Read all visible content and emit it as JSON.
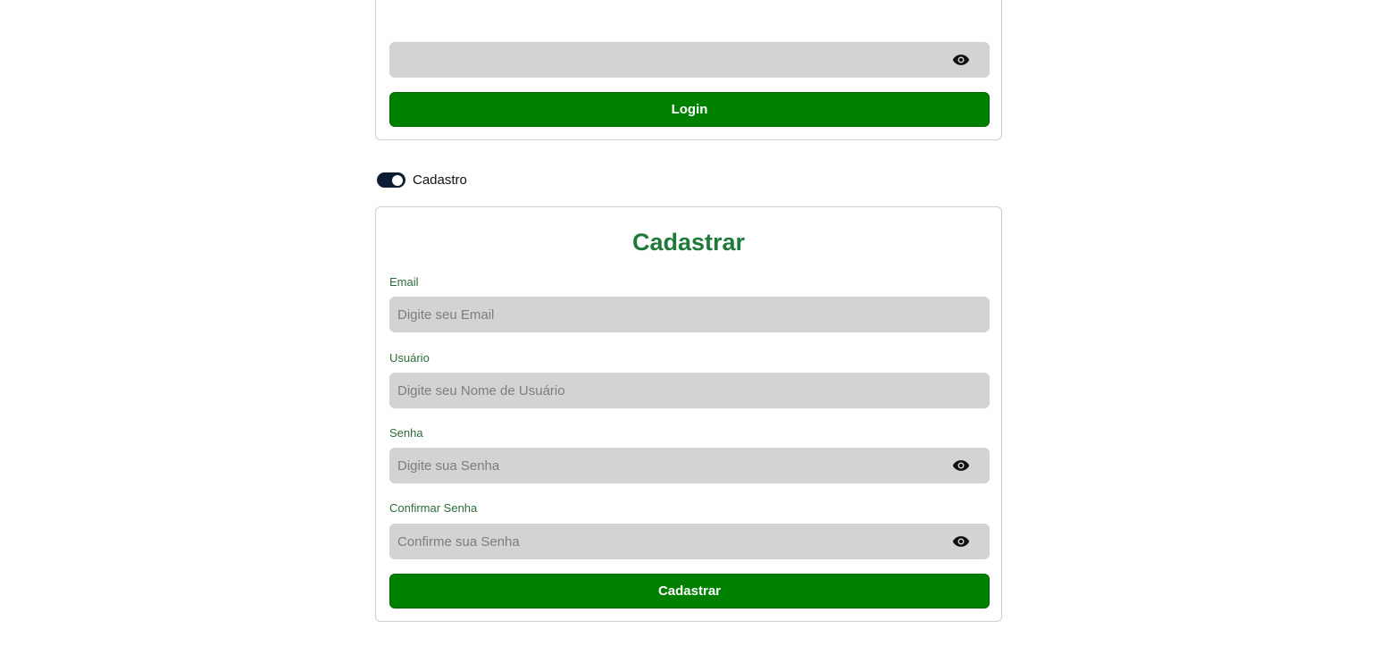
{
  "login": {
    "button_label": "Login",
    "password_placeholder": ""
  },
  "toggle": {
    "label": "Cadastro",
    "checked": true
  },
  "register": {
    "title": "Cadastrar",
    "email_label": "Email",
    "email_placeholder": "Digite seu Email",
    "username_label": "Usuário",
    "username_placeholder": "Digite seu Nome de Usuário",
    "password_label": "Senha",
    "password_placeholder": "Digite sua Senha",
    "confirm_label": "Confirmar Senha",
    "confirm_placeholder": "Confirme sua Senha",
    "button_label": "Cadastrar"
  },
  "icons": {
    "eye": "eye-icon",
    "toggle_knob": "toggle-knob"
  },
  "colors": {
    "primary_button": "#008000",
    "title_green": "#1f7a3a",
    "label_green": "#2e6b3a",
    "field_bg": "#d3d3d3",
    "toggle_bg": "#0e1c33"
  }
}
